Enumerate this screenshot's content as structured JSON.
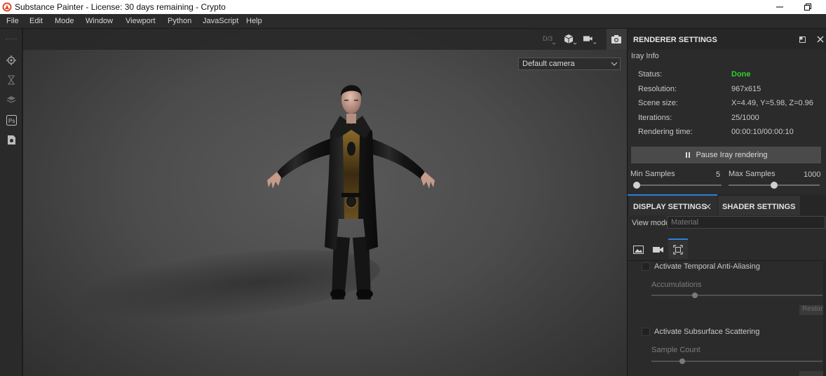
{
  "window": {
    "title": "Substance Painter - License: 30 days remaining - Crypto",
    "logo_icon": "substance-logo-icon",
    "accent_color": "#e04a2f"
  },
  "menu": [
    "File",
    "Edit",
    "Mode",
    "Window",
    "Viewport",
    "Python",
    "JavaScript",
    "Help"
  ],
  "left_tools": [
    "settings-gear-icon",
    "hourglass-icon",
    "layers-icon",
    "photoshop-icon",
    "document-icon"
  ],
  "viewport": {
    "toolbar_icons": [
      "split-view-icon",
      "cube-icon",
      "video-camera-icon",
      "screenshot-camera-icon"
    ],
    "camera_select": "Default camera"
  },
  "renderer": {
    "title": "RENDERER SETTINGS",
    "section": "Iray Info",
    "rows": [
      {
        "label": "Status:",
        "value": "Done"
      },
      {
        "label": "Resolution:",
        "value": "967x615"
      },
      {
        "label": "Scene size:",
        "value": "X=4.49, Y=5.98, Z=0.96"
      },
      {
        "label": "Iterations:",
        "value": "25/1000"
      },
      {
        "label": "Rendering time:",
        "value": "00:00:10/00:00:10"
      }
    ],
    "status_color": "#2fd12f",
    "pause_label": "Pause Iray rendering",
    "min_samples": {
      "label": "Min Samples",
      "value": "5",
      "fraction": 0.0
    },
    "max_samples": {
      "label": "Max Samples",
      "value": "1000",
      "fraction": 0.5
    }
  },
  "settings_tabs": [
    {
      "label": "DISPLAY SETTINGS",
      "active": true
    },
    {
      "label": "SHADER SETTINGS",
      "active": false
    }
  ],
  "display": {
    "view_mode_label": "View mode",
    "view_mode_placeholder": "Material",
    "subtabs": [
      "image-icon",
      "video-camera-icon",
      "fullscreen-icon"
    ],
    "taa_label": "Activate Temporal Anti-Aliasing",
    "accumulations_label": "Accumulations",
    "restore_label": "Restore",
    "sss_label": "Activate Subsurface Scattering",
    "sample_count_label": "Sample Count"
  }
}
